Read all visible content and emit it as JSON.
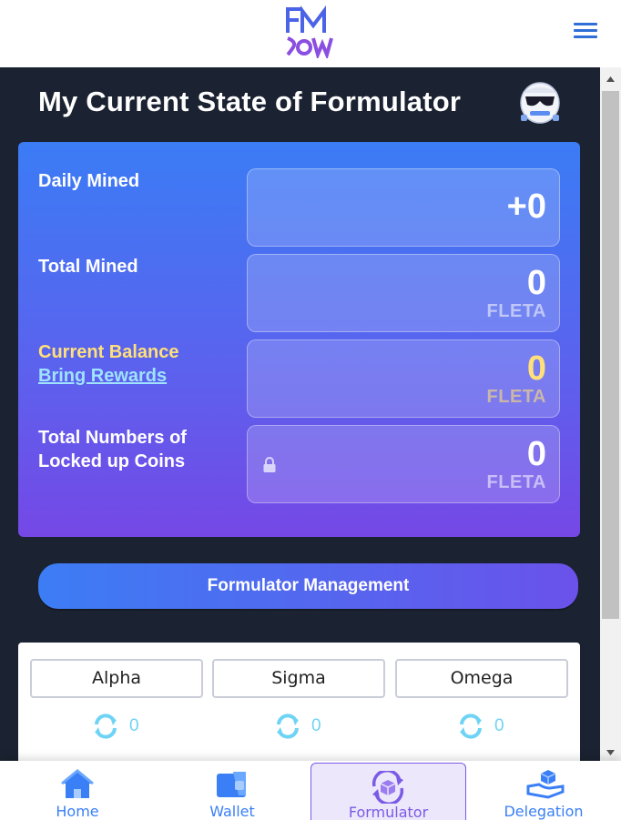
{
  "header": {
    "logo_icon": "fm-logo-icon",
    "menu_icon": "hamburger-menu-icon"
  },
  "page": {
    "title": "My Current State of Formulator",
    "avatar_icon": "sunglasses-avatar-icon"
  },
  "stats": {
    "daily_mined": {
      "label": "Daily Mined",
      "value": "+0"
    },
    "total_mined": {
      "label": "Total Mined",
      "value": "0",
      "unit": "FLETA"
    },
    "current_balance": {
      "label": "Current Balance",
      "link": "Bring Rewards",
      "value": "0",
      "unit": "FLETA"
    },
    "locked_coins": {
      "label_line1": "Total Numbers of",
      "label_line2": "Locked up Coins",
      "value": "0",
      "unit": "FLETA",
      "icon": "lock-icon"
    }
  },
  "management_button": "Formulator Management",
  "tiers": [
    {
      "name": "Alpha",
      "count": "0"
    },
    {
      "name": "Sigma",
      "count": "0"
    },
    {
      "name": "Omega",
      "count": "0"
    }
  ],
  "bottom_nav": [
    {
      "label": "Home",
      "icon": "home-icon"
    },
    {
      "label": "Wallet",
      "icon": "wallet-icon"
    },
    {
      "label": "Formulator",
      "icon": "formulator-icon",
      "active": true
    },
    {
      "label": "Delegation",
      "icon": "delegation-icon"
    }
  ],
  "colors": {
    "accent_blue": "#3a7ff6",
    "accent_purple": "#7b5be6",
    "balance_yellow": "#ffe07a",
    "link_cyan": "#9fe3ff",
    "background_dark": "#1b2231"
  }
}
